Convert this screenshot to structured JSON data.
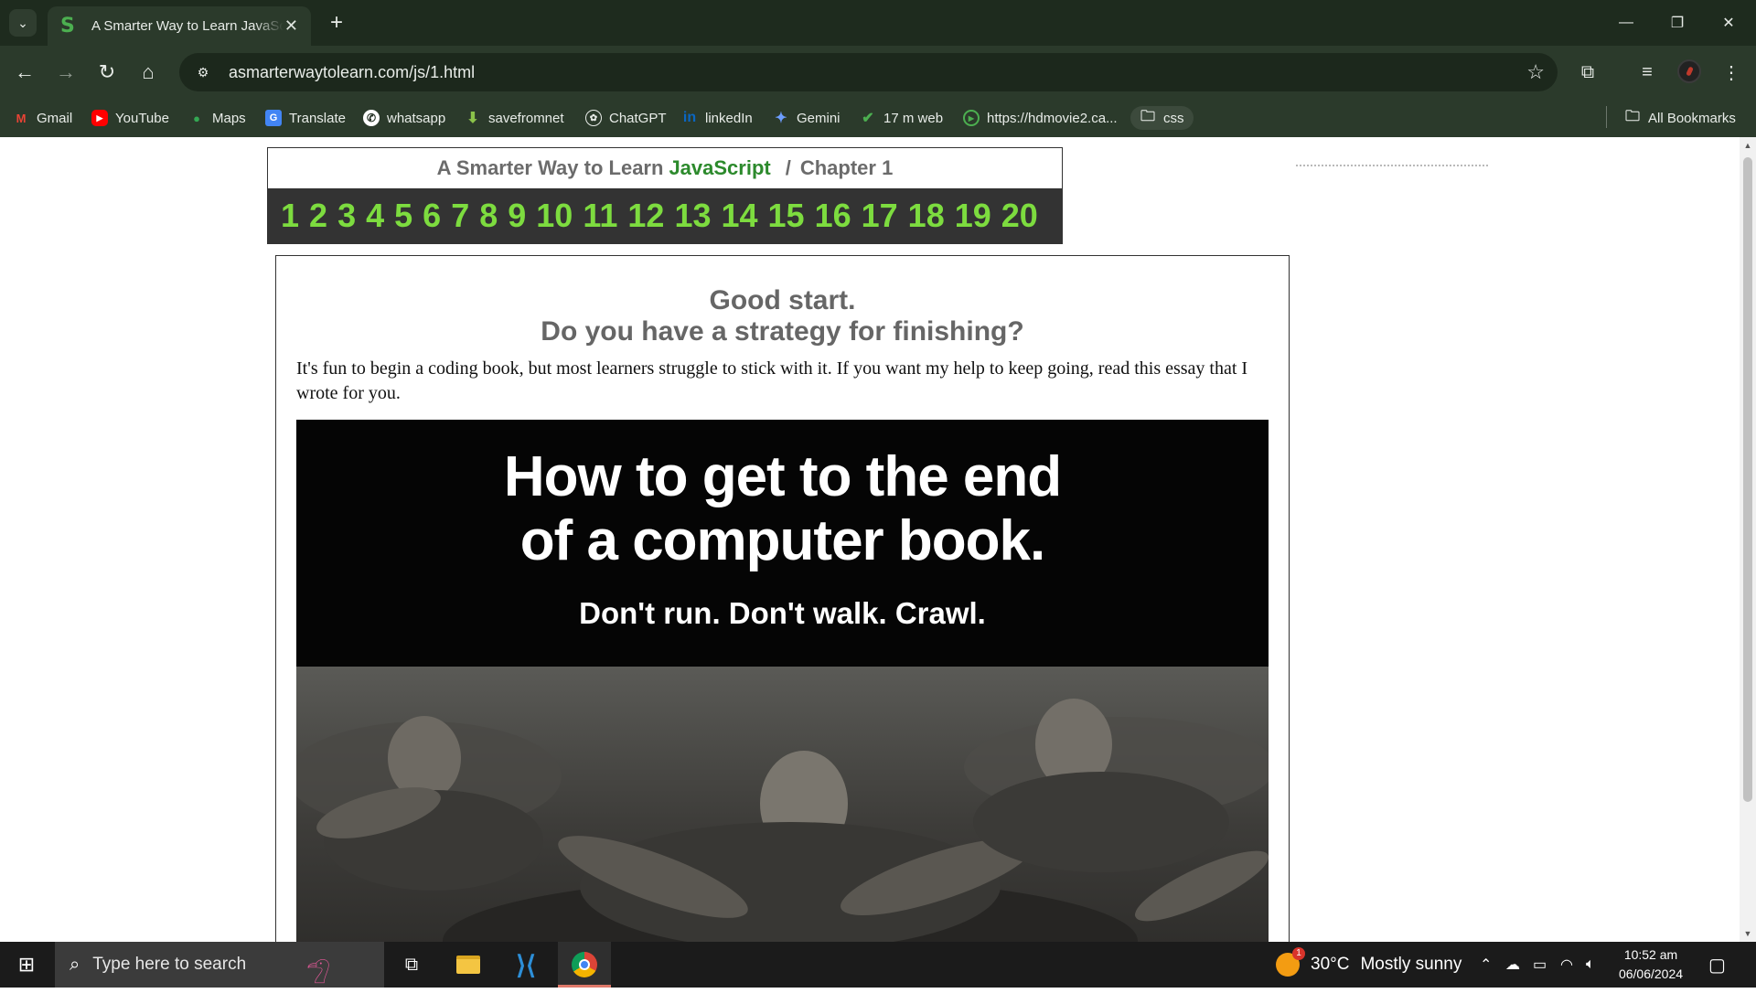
{
  "browser": {
    "tab_title": "A Smarter Way to Learn JavaScript",
    "favicon": "S",
    "url": "asmarterwaytolearn.com/js/1.html",
    "bookmarks": [
      "Gmail",
      "YouTube",
      "Maps",
      "Translate",
      "whatsapp",
      "savefromnet",
      "ChatGPT",
      "linkedIn",
      "Gemini",
      "17 m web",
      "https://hdmovie2.ca...",
      "css"
    ],
    "all_bookmarks": "All Bookmarks"
  },
  "page": {
    "header": {
      "title_prefix": "A Smarter Way to Learn",
      "title_js": "JavaScript",
      "separator": "/",
      "chapter": "Chapter 1"
    },
    "chapters": [
      "1",
      "2",
      "3",
      "4",
      "5",
      "6",
      "7",
      "8",
      "9",
      "10",
      "11",
      "12",
      "13",
      "14",
      "15",
      "16",
      "17",
      "18",
      "19",
      "20"
    ],
    "headline_1": "Good start.",
    "headline_2": "Do you have a strategy for finishing?",
    "intro": "It's fun to begin a coding book, but most learners struggle to stick with it. If you want my help to keep going, read this essay that I wrote for you.",
    "promo": {
      "title_line1": "How to get to the end",
      "title_line2": "of a computer book.",
      "subtitle": "Don't run. Don't walk. Crawl."
    }
  },
  "taskbar": {
    "search_placeholder": "Type here to search",
    "weather_temp": "30°C",
    "weather_text": "Mostly sunny",
    "time": "10:52 am",
    "date": "06/06/2024"
  },
  "colors": {
    "chrome_dark": "#1e2b1e",
    "chrome": "#2b3a2b",
    "chapter_green": "#7ddc3f",
    "js_green": "#2c8a2c"
  }
}
